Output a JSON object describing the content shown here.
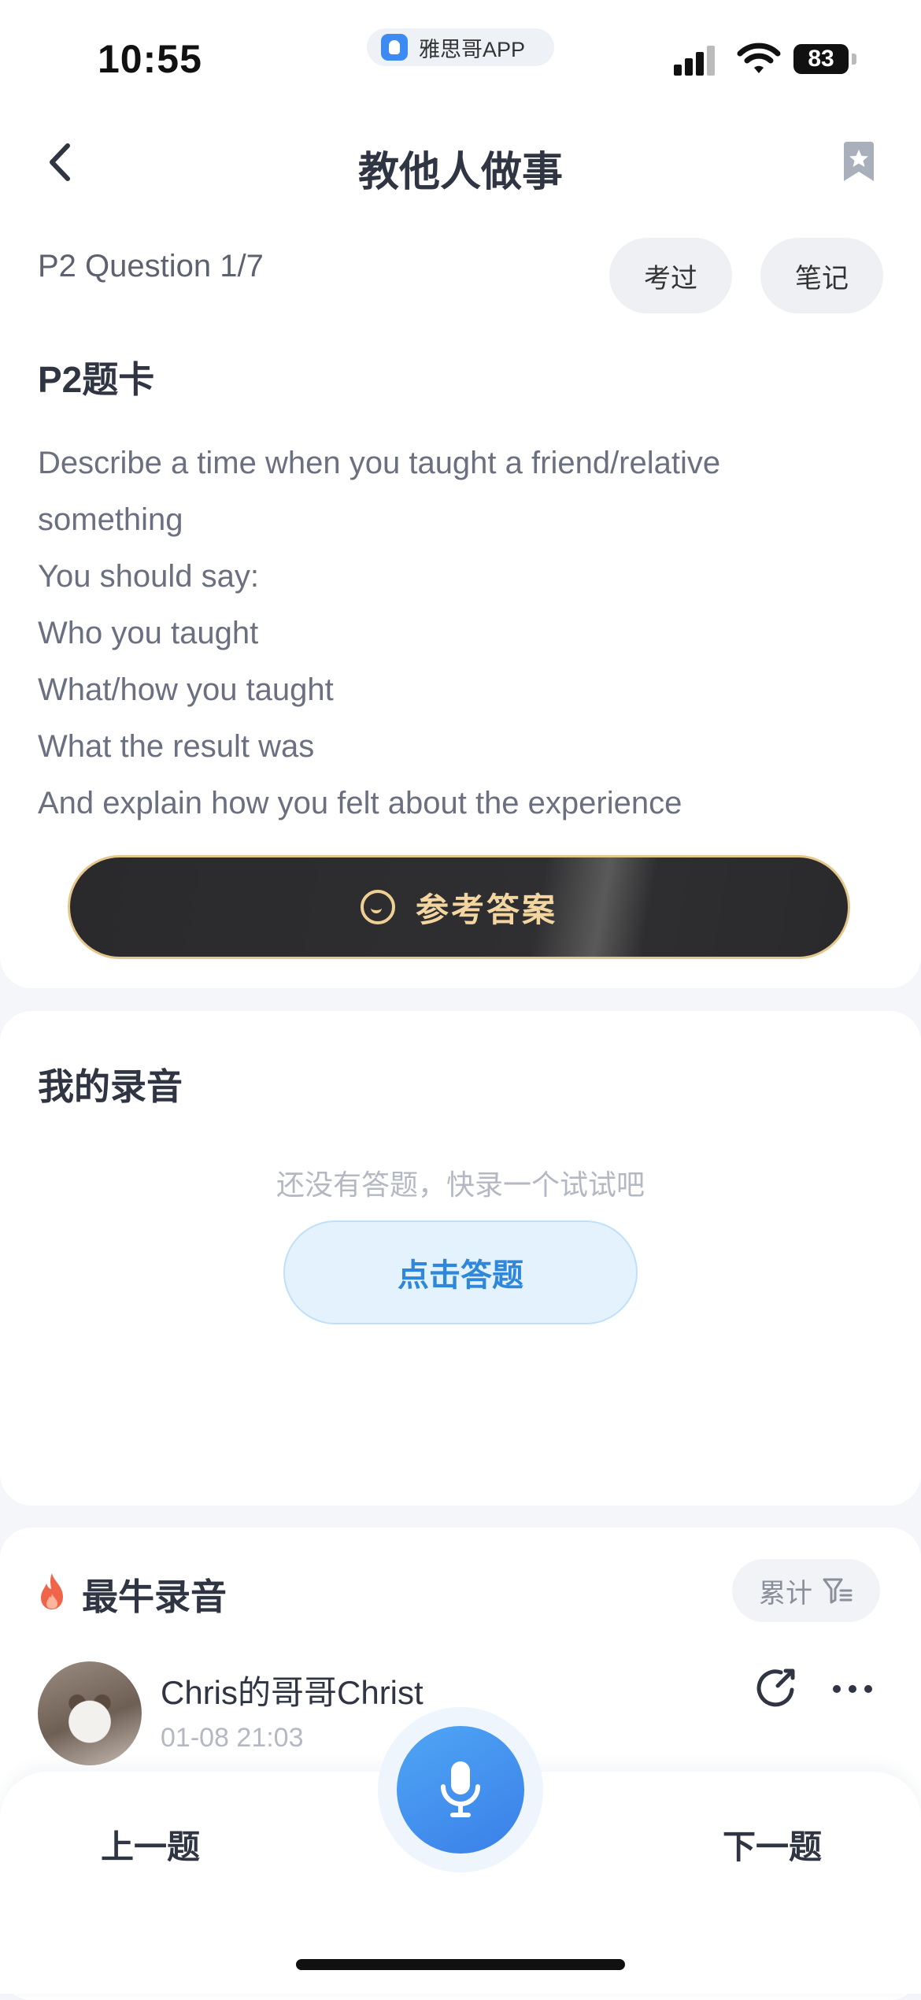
{
  "status_bar": {
    "time": "10:55",
    "app_name": "雅思哥APP",
    "battery": "83"
  },
  "nav": {
    "title": "教他人做事"
  },
  "question": {
    "meta": "P2 Question 1/7",
    "taken_label": "考过",
    "note_label": "笔记",
    "card_title": "P2题卡",
    "prompt_lines": [
      "Describe a time when you taught a friend/relative",
      "something",
      "You should say:",
      "Who you taught",
      "What/how you taught",
      "What the result was",
      "And explain how you felt about the experience"
    ],
    "answer_button": "参考答案"
  },
  "my_recordings": {
    "title": "我的录音",
    "empty_text": "还没有答题，快录一个试试吧",
    "record_button": "点击答题"
  },
  "best_recordings": {
    "title": "最牛录音",
    "filter_label": "累计",
    "items": [
      {
        "user": "Chris的哥哥Christ",
        "date": "01-08 21:03"
      }
    ]
  },
  "bottom_bar": {
    "prev_label": "上一题",
    "next_label": "下一题"
  },
  "colors": {
    "accent_blue": "#3a87e8",
    "gold": "#f3d5a0",
    "dark_button": "#2a2a2c"
  }
}
